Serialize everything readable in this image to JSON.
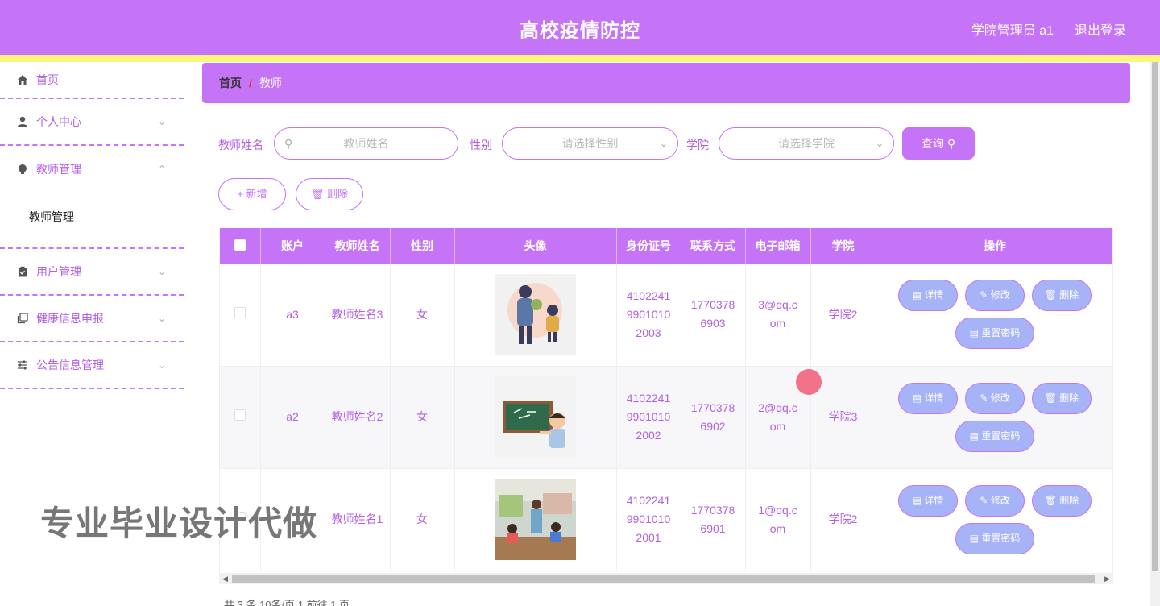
{
  "header": {
    "title": "高校疫情防控",
    "user": "学院管理员 a1",
    "logout": "退出登录"
  },
  "sidebar": {
    "items": [
      {
        "label": "首页",
        "icon": "home-icon"
      },
      {
        "label": "个人中心",
        "icon": "person-icon"
      },
      {
        "label": "教师管理",
        "icon": "bulb-icon",
        "expanded": true,
        "children": [
          "教师管理"
        ]
      },
      {
        "label": "用户管理",
        "icon": "clipboard-icon"
      },
      {
        "label": "健康信息申报",
        "icon": "copy-icon"
      },
      {
        "label": "公告信息管理",
        "icon": "sliders-icon"
      }
    ]
  },
  "breadcrumb": {
    "home": "首页",
    "sep": "/",
    "current": "教师"
  },
  "search": {
    "name_label": "教师姓名",
    "name_placeholder": "教师姓名",
    "gender_label": "性别",
    "gender_placeholder": "请选择性别",
    "college_label": "学院",
    "college_placeholder": "请选择学院",
    "query_button": "查询"
  },
  "actions": {
    "add": "+ 新增",
    "delete": "删除"
  },
  "table": {
    "columns": [
      "账户",
      "教师姓名",
      "性别",
      "头像",
      "身份证号",
      "联系方式",
      "电子邮箱",
      "学院",
      "操作"
    ],
    "rows": [
      {
        "account": "a3",
        "name": "教师姓名3",
        "gender": "女",
        "id_card": "410224199010102003",
        "phone": "17703786903",
        "email": "3@qq.com",
        "college": "学院2"
      },
      {
        "account": "a2",
        "name": "教师姓名2",
        "gender": "女",
        "id_card": "410224199010102002",
        "phone": "17703786902",
        "email": "2@qq.com",
        "college": "学院3"
      },
      {
        "account": "a1",
        "name": "教师姓名1",
        "gender": "女",
        "id_card": "410224199010102001",
        "phone": "17703786901",
        "email": "1@qq.com",
        "college": "学院2"
      }
    ],
    "row_buttons": {
      "detail": "详情",
      "edit": "修改",
      "delete": "删除",
      "reset": "重置密码"
    }
  },
  "pager": {
    "text": "共 3 条    10条/页        1        前往  1  页"
  },
  "watermark": "专业毕业设计代做"
}
